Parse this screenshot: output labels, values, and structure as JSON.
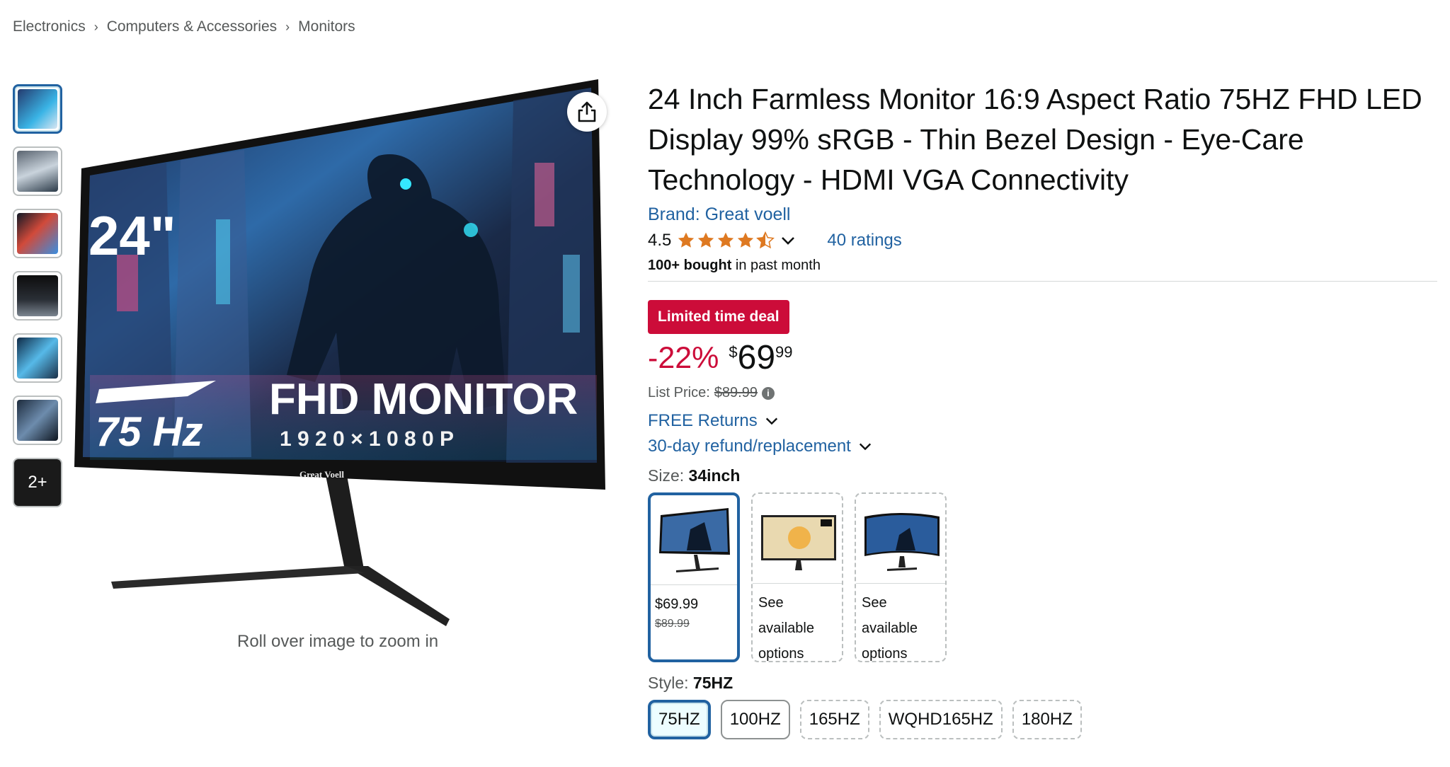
{
  "breadcrumb": [
    "Electronics",
    "Computers & Accessories",
    "Monitors"
  ],
  "gallery": {
    "more_label": "2+",
    "zoom_hint": "Roll over image to zoom in",
    "image": {
      "size_text": "24\"",
      "refresh_text": "75 Hz",
      "headline": "FHD MONITOR",
      "resolution": "1 9 2 0 × 1 0 8 0 P",
      "bezel_brand": "Great Voell"
    }
  },
  "product": {
    "title": "24 Inch Farmless Monitor 16:9 Aspect Ratio 75HZ FHD LED Display 99% sRGB - Thin Bezel Design - Eye-Care Technology - HDMI VGA Connectivity",
    "brand": "Brand: Great voell",
    "rating_value": "4.5",
    "ratings_count": "40 ratings",
    "bought_bold": "100+ bought",
    "bought_rest": " in past month"
  },
  "deal": {
    "badge": "Limited time deal",
    "discount": "-22%",
    "price_symbol": "$",
    "price_whole": "69",
    "price_fraction": "99",
    "list_label": "List Price:",
    "list_price": "$89.99",
    "free_returns": "FREE Returns",
    "refund": "30-day refund/replacement"
  },
  "size": {
    "label": "Size: ",
    "selected": "34inch",
    "options": [
      {
        "price": "$69.99",
        "old_price": "$89.99"
      },
      {
        "text": "See available options"
      },
      {
        "text": "See available options"
      }
    ]
  },
  "style": {
    "label": "Style: ",
    "selected": "75HZ",
    "options": [
      "75HZ",
      "100HZ",
      "165HZ",
      "WQHD165HZ",
      "180HZ"
    ]
  },
  "colors": {
    "link": "#2162a1",
    "deal_red": "#cc0c39",
    "star": "#de7921"
  }
}
